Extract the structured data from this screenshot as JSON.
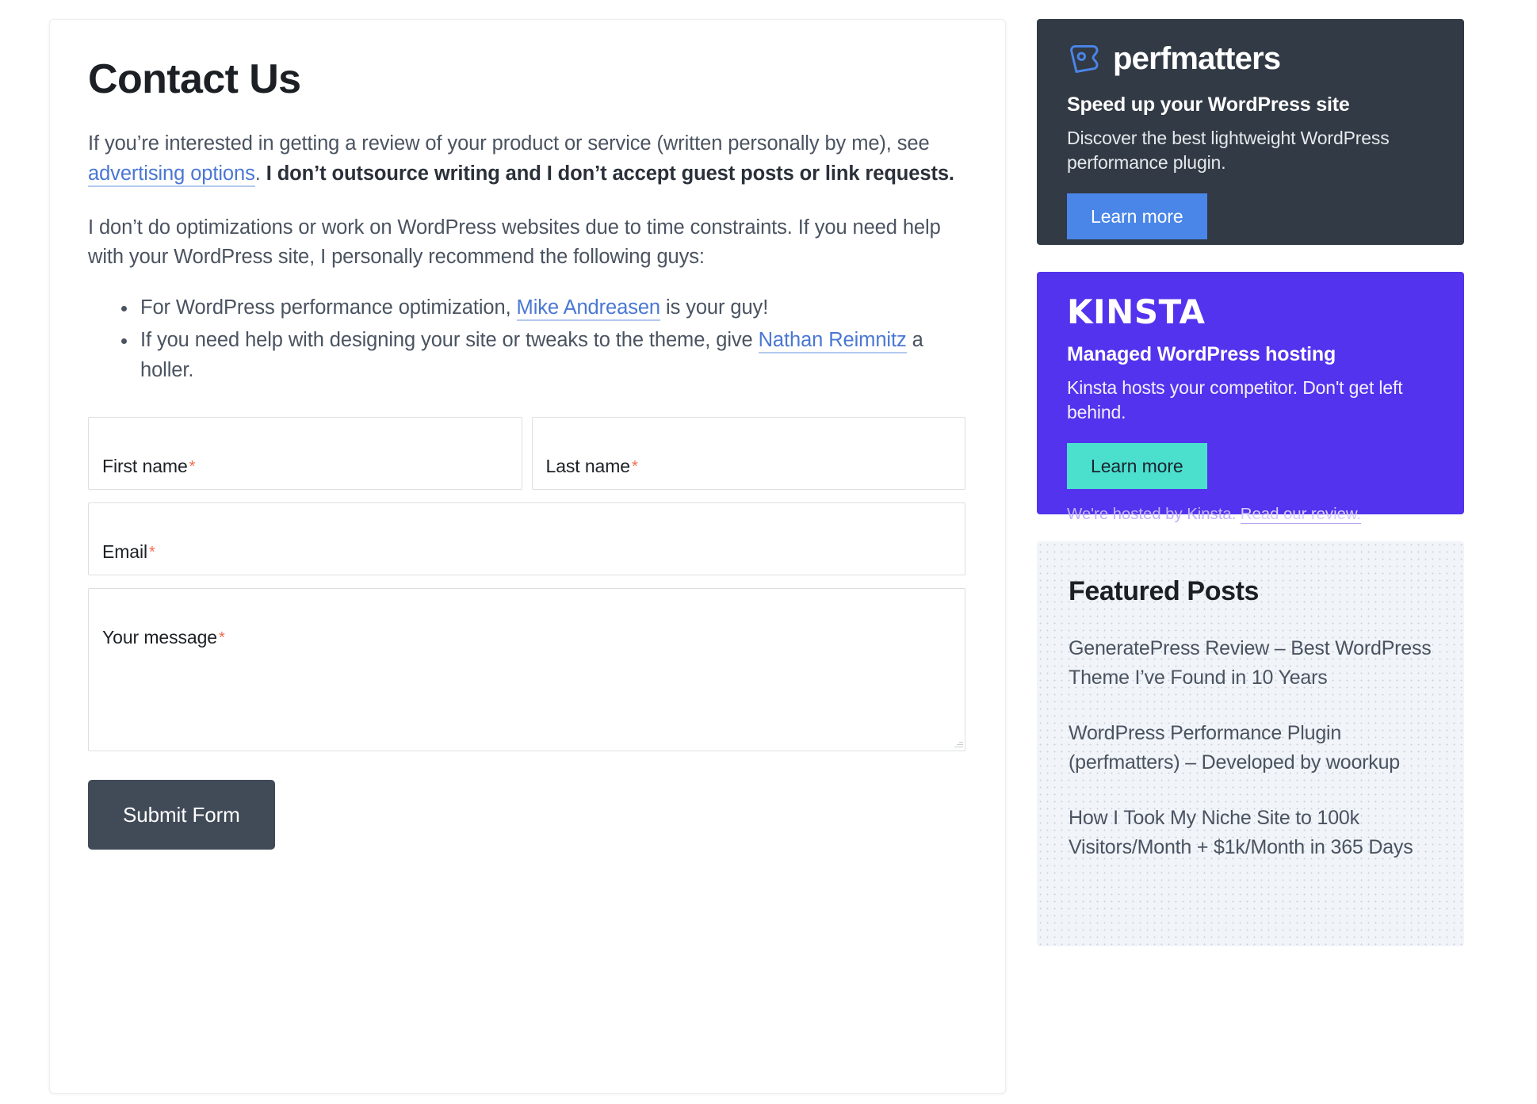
{
  "main": {
    "title": "Contact Us",
    "paragraph1": {
      "part1": "If you’re interested in getting a review of your product or service (written personally by me), see ",
      "link": "advertising options",
      "part2": ". ",
      "bold": "I don’t outsource writing and I don’t accept guest posts or link requests."
    },
    "paragraph2": "I don’t do optimizations or work on WordPress websites due to time constraints. If you need help with your WordPress site, I personally recommend the following guys:",
    "list": [
      {
        "pre": "For WordPress performance optimization, ",
        "link": "Mike Andreasen",
        "post": " is your guy!"
      },
      {
        "pre": "If you need help with designing your site or tweaks to the theme, give ",
        "link": "Nathan Reimnitz",
        "post": " a holler."
      }
    ],
    "form": {
      "first_name_label": "First name",
      "first_name_value": "",
      "last_name_label": "Last name",
      "last_name_value": "",
      "email_label": "Email",
      "email_value": "",
      "message_label": "Your message",
      "message_value": "",
      "required_marker": "*",
      "submit_label": "Submit Form"
    }
  },
  "sidebar": {
    "perfmatters": {
      "brand": "perfmatters",
      "headline": "Speed up your WordPress site",
      "description": "Discover the best lightweight WordPress performance plugin.",
      "cta": "Learn more",
      "bg_color": "#323a45",
      "cta_color": "#4a86e8"
    },
    "kinsta": {
      "brand": "KINSTA",
      "headline": "Managed WordPress hosting",
      "description": "Kinsta hosts your competitor. Don't get left behind.",
      "cta": "Learn more",
      "footnote_text": "We're hosted by Kinsta. ",
      "footnote_link": "Read our review.",
      "bg_color": "#5333ed",
      "cta_color": "#4ae0cd"
    },
    "featured": {
      "title": "Featured Posts",
      "posts": [
        "GeneratePress Review – Best WordPress Theme I’ve Found in 10 Years",
        "WordPress Performance Plugin (perfmatters) – Developed by woorkup",
        "How I Took My Niche Site to 100k Visitors/Month + $1k/Month in 365 Days"
      ]
    }
  }
}
